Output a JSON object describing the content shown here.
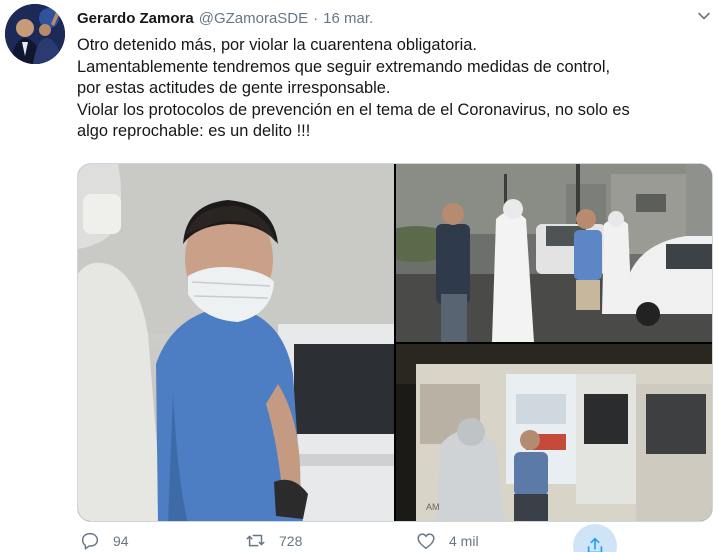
{
  "tweet": {
    "author_name": "Gerardo Zamora",
    "handle": "@GZamoraSDE",
    "separator": "·",
    "date": "16 mar.",
    "text_lines": [
      "Otro detenido más, por violar la cuarentena obligatoria.",
      "Lamentablemente tendremos que seguir extremando medidas de control,",
      "por estas actitudes de gente irresponsable.",
      "Violar los protocolos de prevención en el tema de el Coronavirus, no solo es",
      "algo reprochable: es un delito !!!"
    ]
  },
  "actions": {
    "replies": "94",
    "retweets": "728",
    "likes": "4 mil"
  },
  "icons": {
    "reply": "reply-icon",
    "retweet": "retweet-icon",
    "like": "heart-icon",
    "share": "share-icon",
    "more": "chevron-down-icon"
  },
  "colors": {
    "text": "#14171a",
    "secondary": "#657786",
    "share_bg": "#cfe4f6",
    "accent": "#1da1f2"
  }
}
